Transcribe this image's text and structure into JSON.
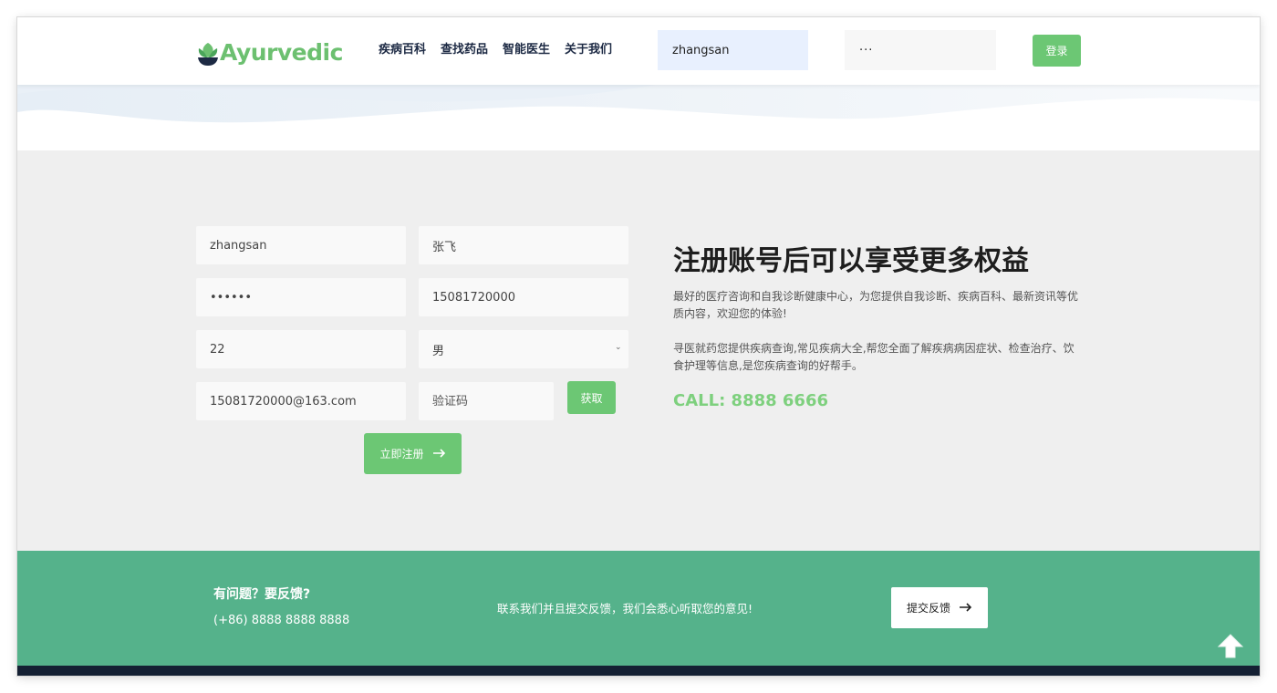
{
  "header": {
    "logo_text": "Ayurvedic",
    "nav": [
      "疾病百科",
      "查找药品",
      "智能医生",
      "关于我们"
    ],
    "username_value": "zhangsan",
    "password_value": "···",
    "login_label": "登录"
  },
  "form": {
    "username": "zhangsan",
    "realname": "张飞",
    "password": "••••••",
    "phone": "15081720000",
    "age": "22",
    "gender": "男",
    "email": "15081720000@163.com",
    "code_placeholder": "验证码",
    "get_code_label": "获取",
    "register_label": "立即注册"
  },
  "info": {
    "headline": "注册账号后可以享受更多权益",
    "para1": "最好的医疗咨询和自我诊断健康中心，为您提供自我诊断、疾病百科、最新资讯等优质内容，欢迎您的体验!",
    "para2": "寻医就药您提供疾病查询,常见疾病大全,帮您全面了解疾病病因症状、检查治疗、饮食护理等信息,是您疾病查询的好帮手。",
    "call": "CALL: 8888 6666"
  },
  "footer": {
    "title": "有问题？要反馈?",
    "phone": "(+86) 8888 8888 8888",
    "message": "联系我们并且提交反馈，我们会悉心听取您的意见!",
    "feedback_label": "提交反馈"
  },
  "colors": {
    "accent_green": "#6cc774",
    "footer_green": "#55b28b",
    "dark_navy": "#142033"
  }
}
